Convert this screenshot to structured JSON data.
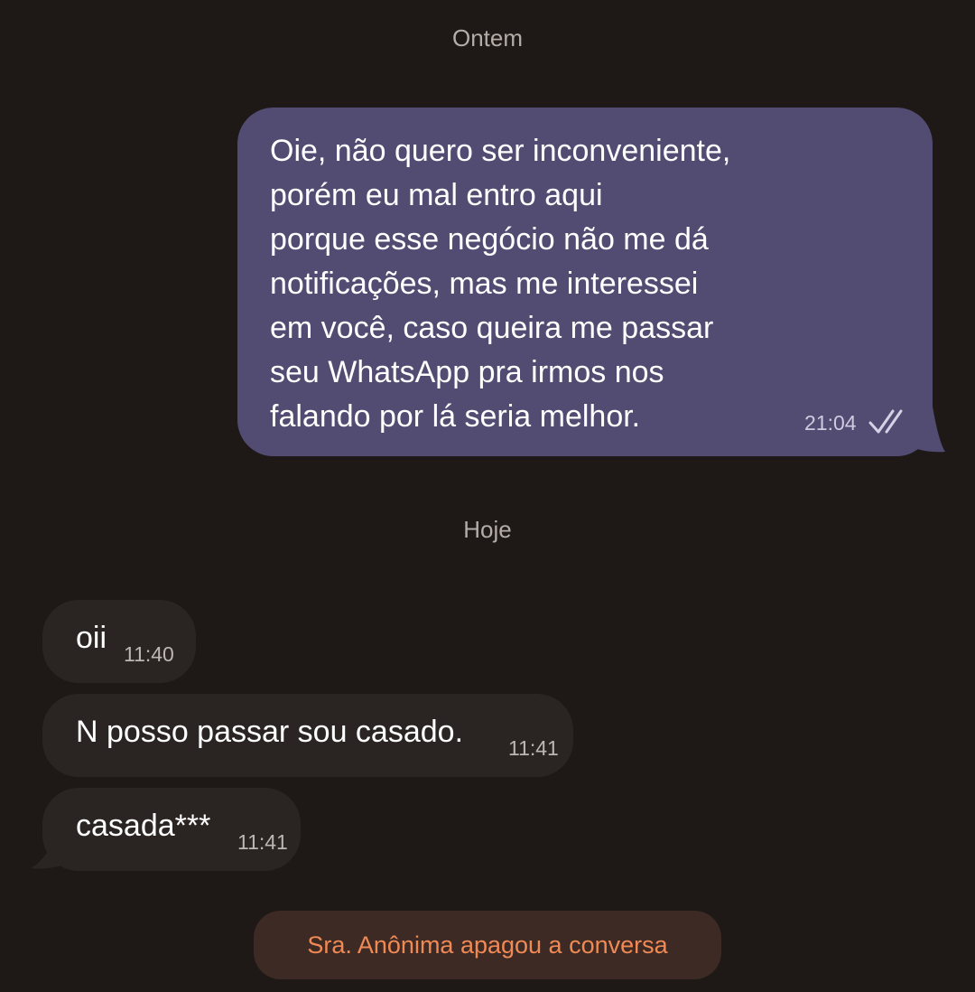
{
  "chat": {
    "sep_yesterday": "Ontem",
    "sep_today": "Hoje",
    "outgoing": {
      "text": "Oie, não quero ser inconveniente,\nporém eu mal entro aqui\nporque esse negócio não me dá\nnotificações, mas me interessei\nem você, caso queira me passar\nseu WhatsApp pra irmos nos\nfalando por lá seria melhor.",
      "time": "21:04",
      "status_icon": "double-check-icon"
    },
    "incoming": [
      {
        "text": "oii",
        "time": "11:40"
      },
      {
        "text": "N posso passar sou casado.",
        "time": "11:41"
      },
      {
        "text": "casada***",
        "time": "11:41"
      }
    ],
    "system_notice": "Sra. Anônima apagou a conversa"
  },
  "colors": {
    "background": "#1e1917",
    "outgoing_bubble": "#524b72",
    "incoming_bubble": "#2a2523",
    "system_pill": "#3d2a24",
    "system_text": "#f08a55"
  }
}
